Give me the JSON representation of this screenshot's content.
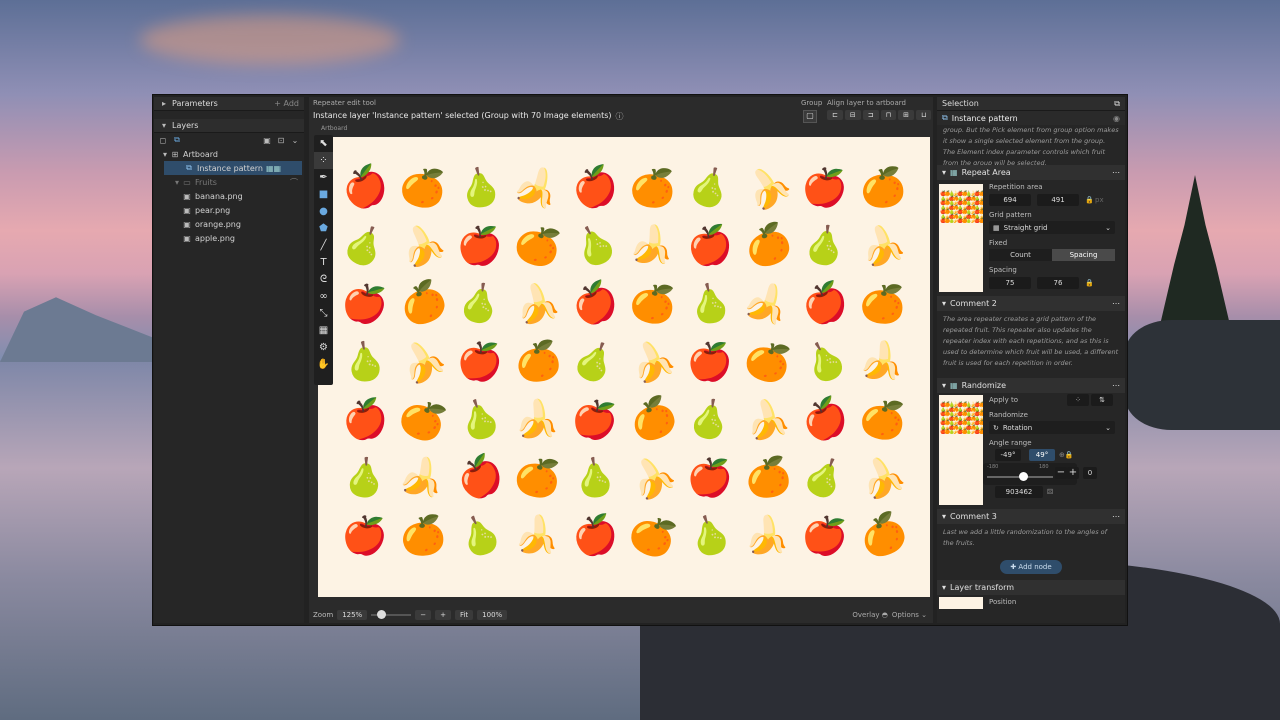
{
  "left": {
    "parameters": "Parameters",
    "add": "+ Add",
    "layers": "Layers",
    "tree": [
      {
        "label": "Artboard"
      },
      {
        "label": "Instance pattern"
      },
      {
        "label": "Fruits"
      },
      {
        "label": "banana.png"
      },
      {
        "label": "pear.png"
      },
      {
        "label": "orange.png"
      },
      {
        "label": "apple.png"
      }
    ]
  },
  "top": {
    "tool": "Repeater edit tool",
    "status": "Instance layer 'Instance pattern' selected (Group with 70 Image elements)",
    "group": "Group",
    "align": "Align layer to artboard",
    "artboard": "Artboard"
  },
  "grid": [
    [
      "apple",
      "orange",
      "pear",
      "banana",
      "apple",
      "orange",
      "pear",
      "banana",
      "apple",
      "orange"
    ],
    [
      "pear",
      "banana",
      "apple",
      "orange",
      "pear",
      "banana",
      "apple",
      "orange",
      "pear",
      "banana"
    ],
    [
      "apple",
      "orange",
      "pear",
      "banana",
      "apple",
      "orange",
      "pear",
      "banana",
      "apple",
      "orange"
    ],
    [
      "pear",
      "banana",
      "apple",
      "orange",
      "pear",
      "banana",
      "apple",
      "orange",
      "pear",
      "banana"
    ],
    [
      "apple",
      "orange",
      "pear",
      "banana",
      "apple",
      "orange",
      "pear",
      "banana",
      "apple",
      "orange"
    ],
    [
      "pear",
      "banana",
      "apple",
      "orange",
      "pear",
      "banana",
      "apple",
      "orange",
      "pear",
      "banana"
    ],
    [
      "apple",
      "orange",
      "pear",
      "banana",
      "apple",
      "orange",
      "pear",
      "banana",
      "apple",
      "orange"
    ]
  ],
  "fruit_glyphs": {
    "apple": "🍎",
    "orange": "🍊",
    "pear": "🍐",
    "banana": "🍌"
  },
  "bottom": {
    "zoom": "Zoom",
    "zoom_val": "125%",
    "minus": "−",
    "plus": "+",
    "fit": "Fit",
    "pct": "100%",
    "overlay": "Overlay",
    "options": "Options"
  },
  "right": {
    "selection": "Selection",
    "instance": "Instance pattern",
    "intro": "group. But the Pick element from group option makes it show a single selected element from the group. The Element index parameter controls which fruit from the group will be selected.",
    "repeat": "Repeat Area",
    "rep_area": "Repetition area",
    "w": "694",
    "h": "491",
    "px": "px",
    "grid_pattern": "Grid pattern",
    "grid_val": "Straight grid",
    "fixed": "Fixed",
    "count": "Count",
    "spacing": "Spacing",
    "spacing_lbl": "Spacing",
    "sx": "75",
    "sy": "76",
    "comment2": "Comment 2",
    "comment2_text": "The area repeater creates a grid pattern of the repeated fruit. This repeater also updates the repeater index with each repetitions, and as this is used to determine which fruit will be used, a different fruit is used for each repetition in order.",
    "randomize": "Randomize",
    "apply_to": "Apply to",
    "randomize_lbl": "Randomize",
    "rot": "Rotation",
    "angle": "Angle range",
    "a1": "-49°",
    "a2": "49°",
    "min": "-180",
    "max": "180",
    "zero": "0",
    "seed": "903462",
    "comment3": "Comment 3",
    "comment3_text": "Last we add a little randomization to the angles of the fruits.",
    "add_node": "Add node",
    "layer_transform": "Layer transform",
    "position": "Position"
  }
}
